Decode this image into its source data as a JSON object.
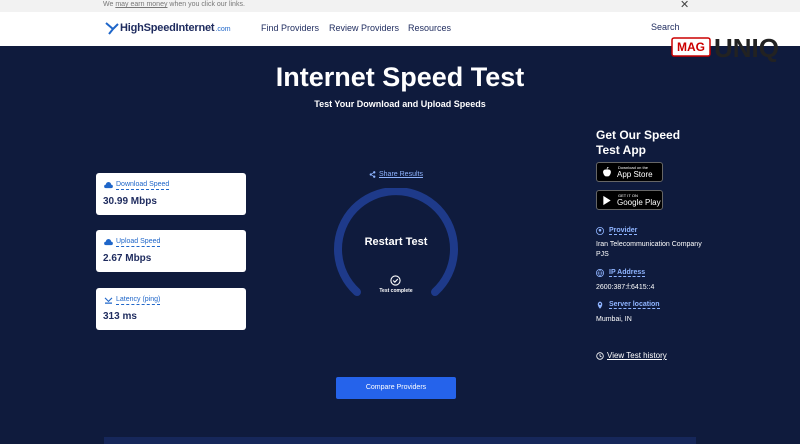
{
  "disclaimer": {
    "prefix": "We",
    "link": "may earn money",
    "suffix": "when you click our links."
  },
  "nav": {
    "logo_text": "HighSpeedInternet",
    "logo_suffix": ".com",
    "links": [
      "Find Providers",
      "Review Providers",
      "Resources"
    ],
    "search_label": "Search"
  },
  "page": {
    "title": "Internet Speed Test",
    "subtitle": "Test Your Download and Upload Speeds"
  },
  "stats": [
    {
      "label": "Download Speed",
      "value": "30.99 Mbps",
      "icon": "download-cloud-icon"
    },
    {
      "label": "Upload Speed",
      "value": "2.67 Mbps",
      "icon": "upload-cloud-icon"
    },
    {
      "label": "Latency (ping)",
      "value": "313 ms",
      "icon": "latency-icon"
    }
  ],
  "gauge": {
    "share_label": "Share Results",
    "restart_label": "Restart Test",
    "status": "Test complete"
  },
  "compare_label": "Compare Providers",
  "app": {
    "title": "Get Our Speed Test App",
    "appstore_small": "Download on the",
    "appstore_big": "App Store",
    "googleplay_small": "GET IT ON",
    "googleplay_big": "Google Play"
  },
  "info": {
    "provider_label": "Provider",
    "provider_value": "Iran Telecommunication Company PJS",
    "ip_label": "IP Address",
    "ip_value": "2600:387:f:6415::4",
    "server_label": "Server location",
    "server_value": "Mumbai, IN"
  },
  "history_label": "View Test history",
  "watermark": {
    "left": "MAG",
    "right": "UNIQ"
  },
  "colors": {
    "background": "#0f1b3d",
    "accent": "#2563eb",
    "link": "#8fb4ff"
  }
}
